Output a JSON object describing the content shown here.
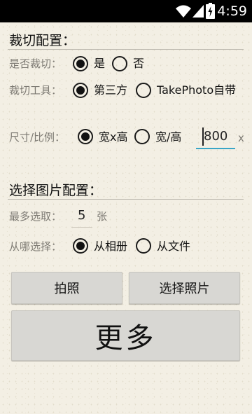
{
  "status_bar": {
    "time": "4:59"
  },
  "crop_config": {
    "title": "裁切配置：",
    "crop_row": {
      "label": "是否裁切：",
      "options": [
        {
          "label": "是",
          "checked": true
        },
        {
          "label": "否",
          "checked": false
        }
      ]
    },
    "tool_row": {
      "label": "裁切工具：",
      "options": [
        {
          "label": "第三方",
          "checked": true
        },
        {
          "label": "TakePhoto自带",
          "checked": false
        }
      ]
    },
    "size_row": {
      "label": "尺寸/比例：",
      "options": [
        {
          "label": "宽x高",
          "checked": true
        },
        {
          "label": "宽/高",
          "checked": false
        }
      ],
      "width_value": "800",
      "separator": "x"
    }
  },
  "select_config": {
    "title": "选择图片配置：",
    "max_row": {
      "label": "最多选取：",
      "value": "5",
      "unit": "张"
    },
    "source_row": {
      "label": "从哪选择：",
      "options": [
        {
          "label": "从相册",
          "checked": true
        },
        {
          "label": "从文件",
          "checked": false
        }
      ]
    }
  },
  "buttons": {
    "take_photo": "拍照",
    "select_photo": "选择照片",
    "more": "更多"
  }
}
